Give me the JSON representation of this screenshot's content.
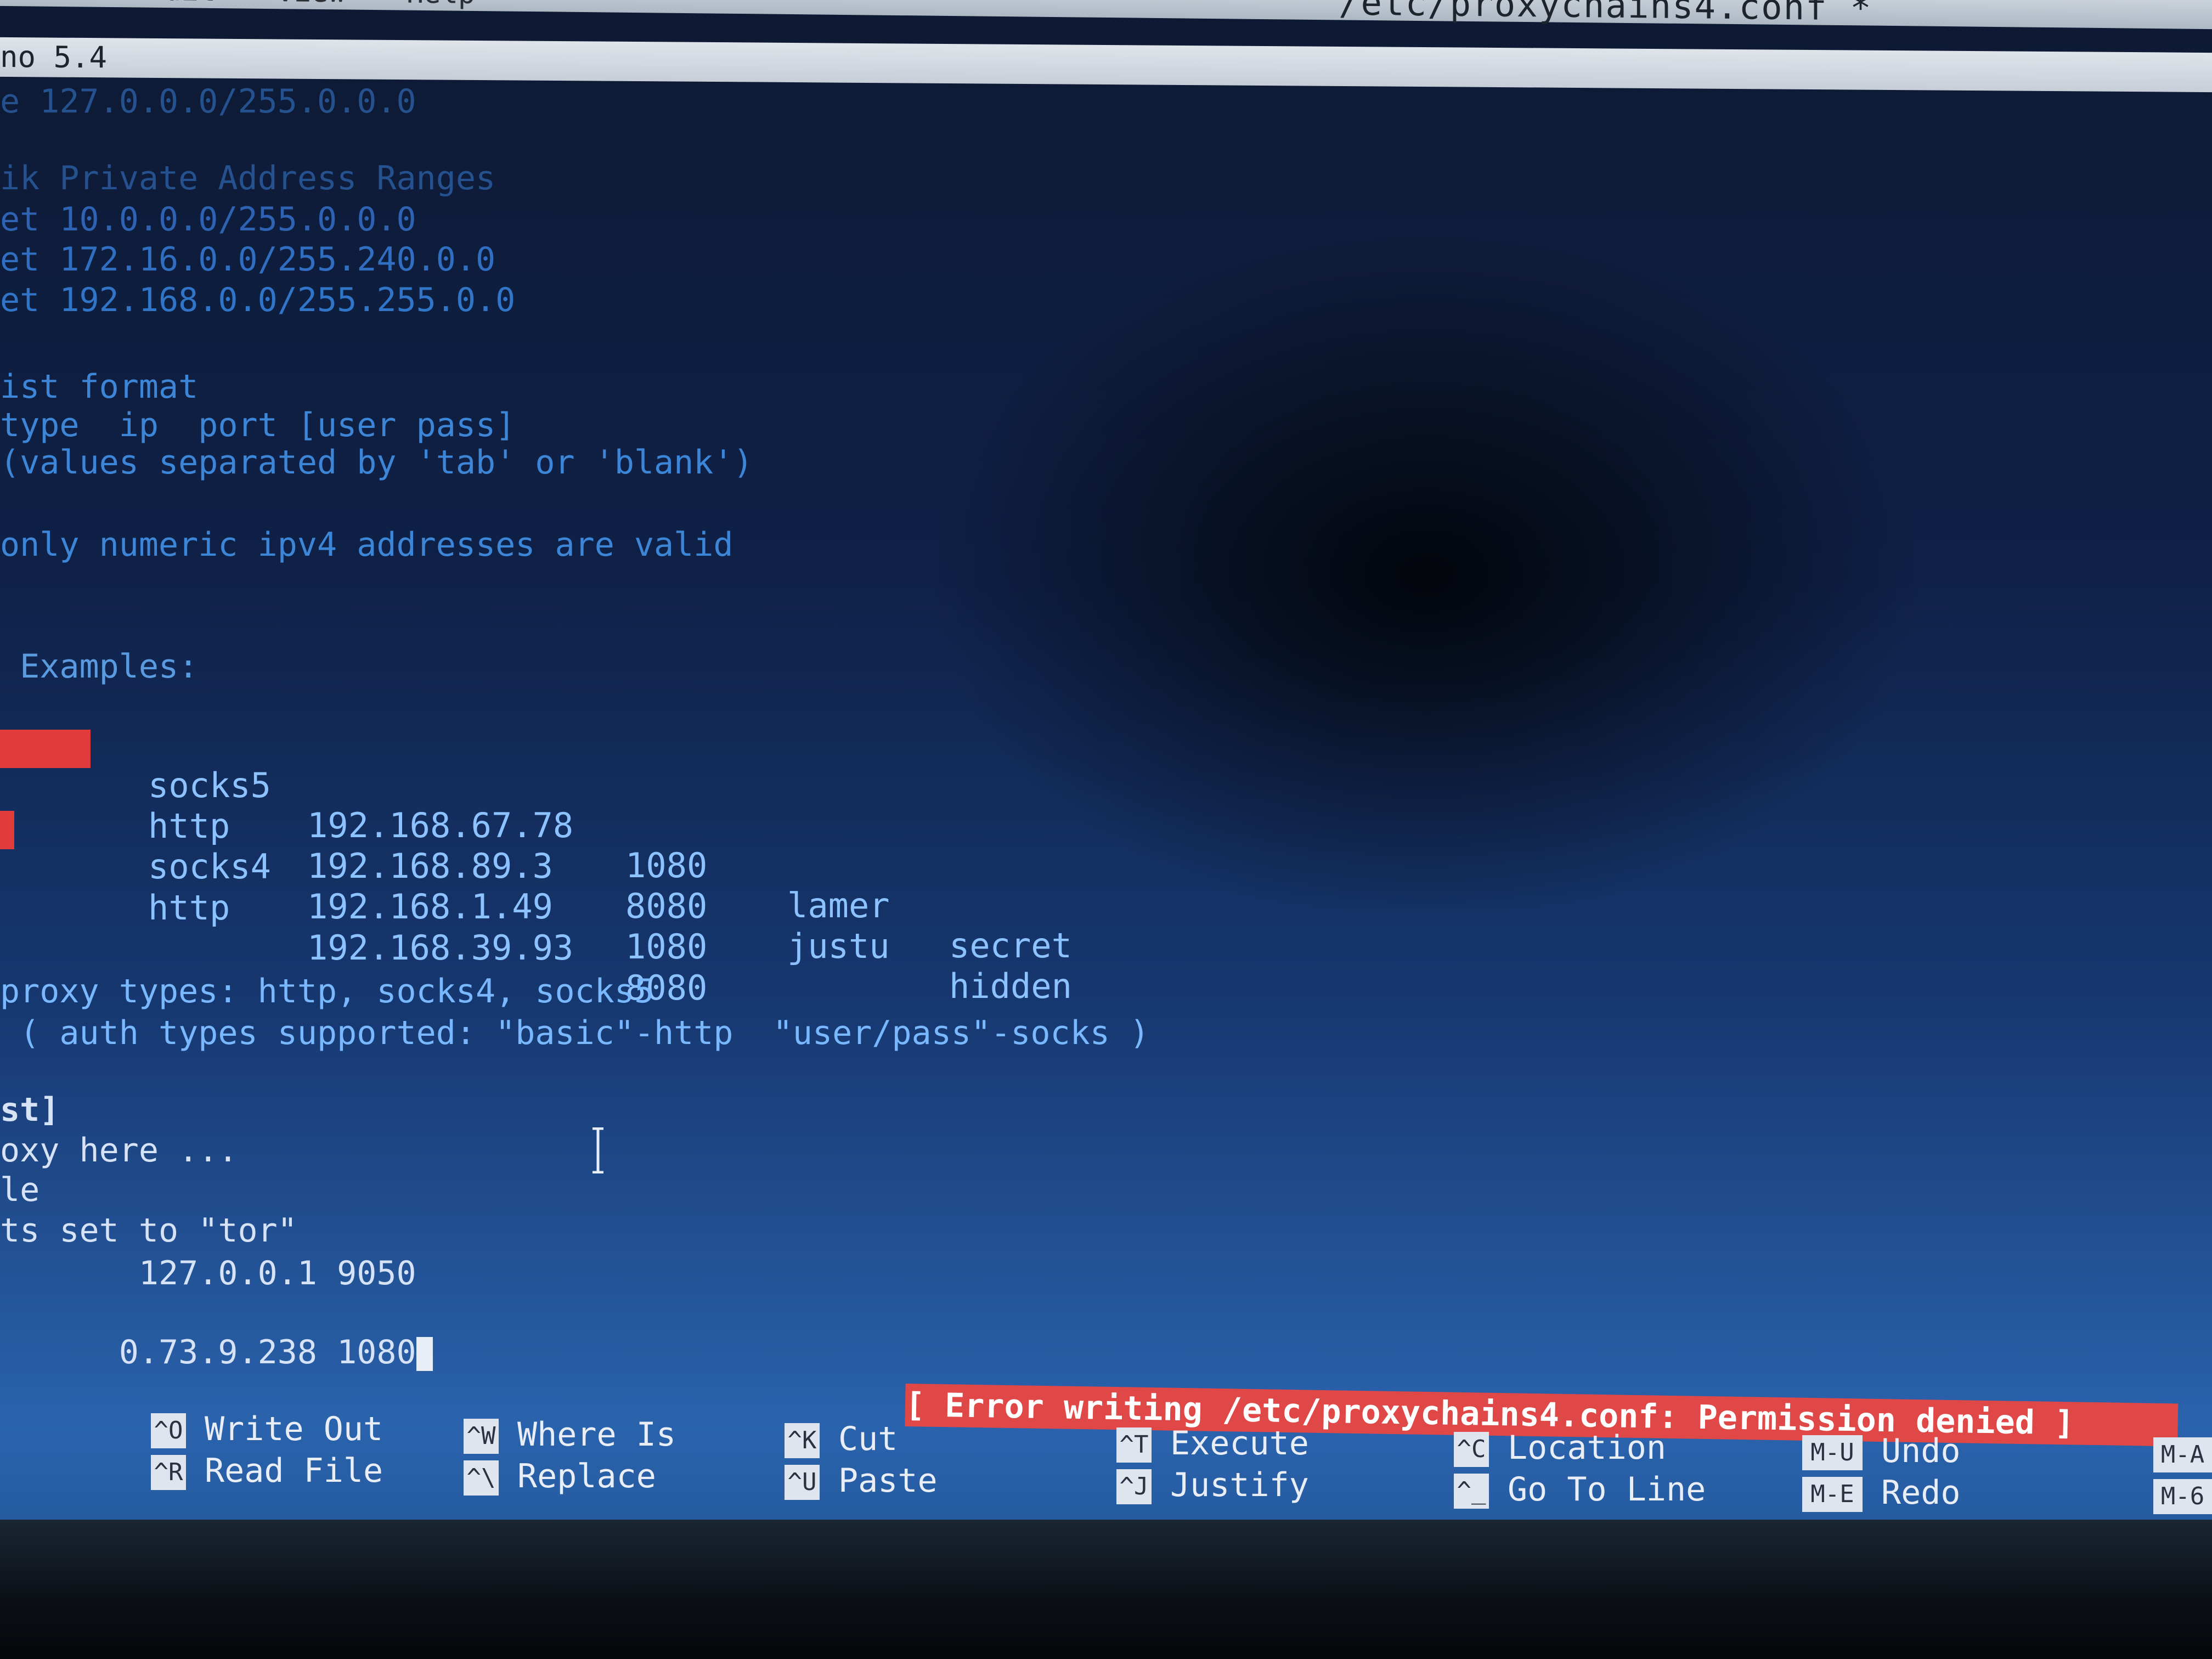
{
  "menu": {
    "options_label": "tions",
    "edit_label": "Edit",
    "view_label": "View",
    "help_label": "Help",
    "window_title": "/etc/proxychains4.conf *"
  },
  "editor": {
    "title": "no 5.4"
  },
  "file_lines": {
    "l1": "e 127.0.0.0/255.0.0.0",
    "l2": "ik Private Address Ranges",
    "l3": "et 10.0.0.0/255.0.0.0",
    "l4": "et 172.16.0.0/255.240.0.0",
    "l5": "et 192.168.0.0/255.255.0.0",
    "l6": "ist format",
    "l7": "type  ip  port [user pass]",
    "l8": "(values separated by 'tab' or 'blank')",
    "l9": "only numeric ipv4 addresses are valid",
    "l10": " Examples:",
    "l11": "proxy types: http, socks4, socks5",
    "l12": " ( auth types supported: \"basic\"-http  \"user/pass\"-socks )",
    "l13": "st]",
    "l14": "oxy here ...",
    "l15": "le",
    "l16": "ts set to \"tor\"",
    "l17": "       127.0.0.1 9050",
    "l18": "0.73.9.238 1080"
  },
  "examples": [
    {
      "type": "socks5",
      "ip": "192.168.67.78",
      "port": "1080",
      "user": "lamer",
      "pass": "secret"
    },
    {
      "type": "http",
      "ip": "192.168.89.3",
      "port": "8080",
      "user": "justu",
      "pass": "hidden"
    },
    {
      "type": "socks4",
      "ip": "192.168.1.49",
      "port": "1080",
      "user": "",
      "pass": ""
    },
    {
      "type": "http",
      "ip": "192.168.39.93",
      "port": "8080",
      "user": "",
      "pass": ""
    }
  ],
  "status": {
    "message": "[ Error writing /etc/proxychains4.conf: Permission denied ]"
  },
  "shortcuts": [
    {
      "key1": "^O",
      "label1": "Write Out",
      "key2": "^R",
      "label2": "Read File"
    },
    {
      "key1": "^W",
      "label1": "Where Is",
      "key2": "^\\",
      "label2": "Replace"
    },
    {
      "key1": "^K",
      "label1": "Cut",
      "key2": "^U",
      "label2": "Paste"
    },
    {
      "key1": "^T",
      "label1": "Execute",
      "key2": "^J",
      "label2": "Justify"
    },
    {
      "key1": "^C",
      "label1": "Location",
      "key2": "^_",
      "label2": "Go To Line"
    },
    {
      "key1": "M-U",
      "label1": "Undo",
      "key2": "M-E",
      "label2": "Redo"
    },
    {
      "key1": "M-A",
      "label1": "",
      "key2": "M-6",
      "label2": ""
    }
  ],
  "colors": {
    "status_bg": "#e04848",
    "text_blue": "#3d86d7",
    "text_cyan": "#8cc2ff"
  }
}
